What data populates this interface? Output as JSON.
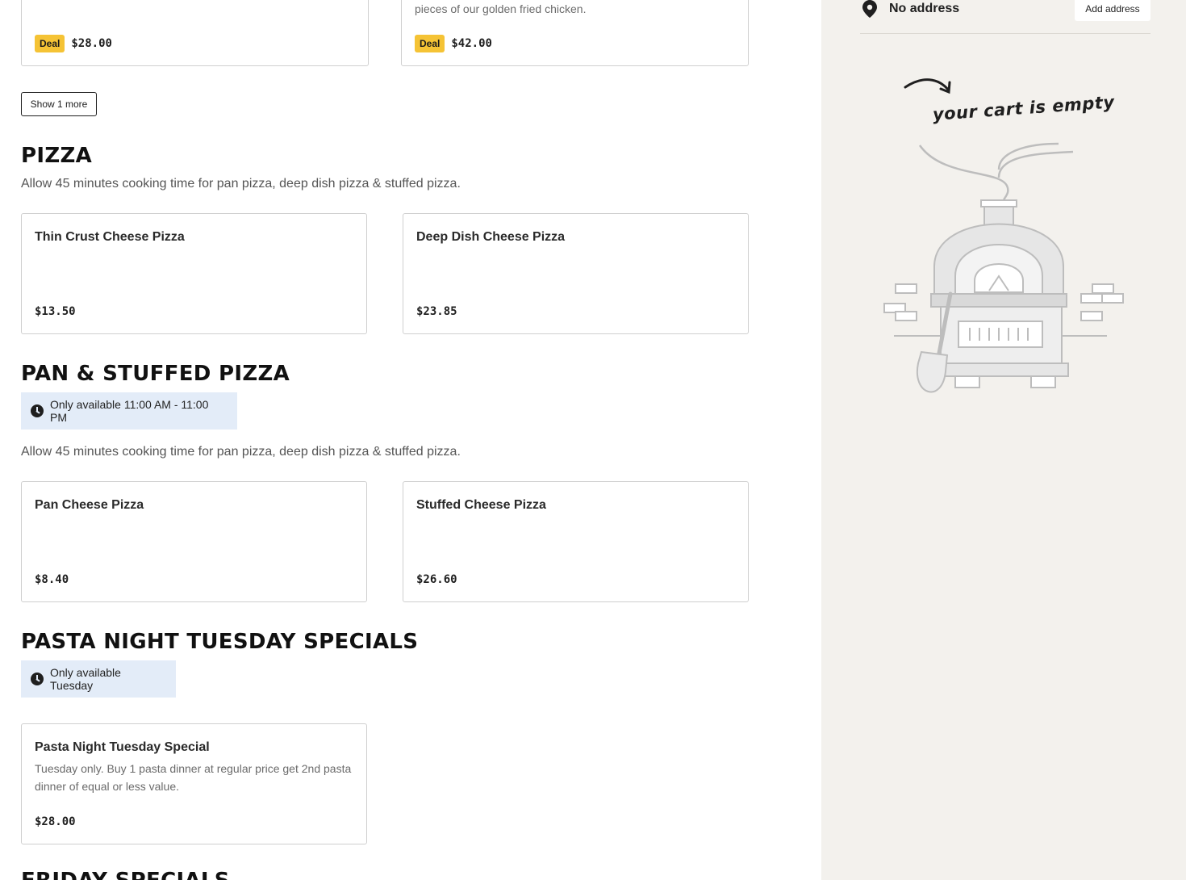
{
  "deals": [
    {
      "desc": "",
      "price": "$28.00",
      "badge": "Deal"
    },
    {
      "desc": "pieces of our golden fried chicken.",
      "price": "$42.00",
      "badge": "Deal"
    }
  ],
  "show_more_label": "Show 1 more",
  "pizza": {
    "title": "PIZZA",
    "note": "Allow 45 minutes cooking time for pan pizza, deep dish pizza & stuffed pizza.",
    "items": [
      {
        "name": "Thin Crust Cheese Pizza",
        "price": "$13.50"
      },
      {
        "name": "Deep Dish Cheese Pizza",
        "price": "$23.85"
      }
    ]
  },
  "pan": {
    "title": "PAN & STUFFED PIZZA",
    "availability": "Only available 11:00 AM - 11:00 PM",
    "note": "Allow 45 minutes cooking time for pan pizza, deep dish pizza & stuffed pizza.",
    "items": [
      {
        "name": "Pan Cheese Pizza",
        "price": "$8.40"
      },
      {
        "name": "Stuffed Cheese Pizza",
        "price": "$26.60"
      }
    ]
  },
  "pasta": {
    "title": "PASTA NIGHT TUESDAY SPECIALS",
    "availability": "Only available Tuesday",
    "items": [
      {
        "name": "Pasta Night Tuesday Special",
        "desc": "Tuesday only. Buy 1 pasta dinner at regular price get 2nd pasta dinner of equal or less value.",
        "price": "$28.00"
      }
    ]
  },
  "friday": {
    "title": "FRIDAY SPECIALS"
  },
  "sidebar": {
    "address": "No address",
    "add_address_label": "Add address",
    "cart_empty_text": "your cart is empty",
    "pin_icon": "map-pin-icon",
    "illustration": "pizza-oven-illustration"
  },
  "colors": {
    "deal_badge": "#f5c335",
    "avail_bg": "#e3ecf8",
    "sidebar_bg": "#f3f1ed"
  }
}
